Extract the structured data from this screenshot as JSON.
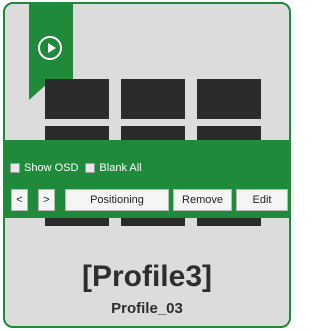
{
  "colors": {
    "accent": "#1e8a3a",
    "card_bg": "#dcdcdc",
    "tile": "#2b2b2b"
  },
  "controls": {
    "show_osd_label": "Show OSD",
    "blank_all_label": "Blank All",
    "prev_label": "<",
    "next_label": ">",
    "positioning_label": "Positioning",
    "remove_label": "Remove",
    "edit_label": "Edit"
  },
  "profile": {
    "title": "[Profile3]",
    "name": "Profile_03"
  },
  "icons": {
    "play": "play-circle-icon"
  }
}
